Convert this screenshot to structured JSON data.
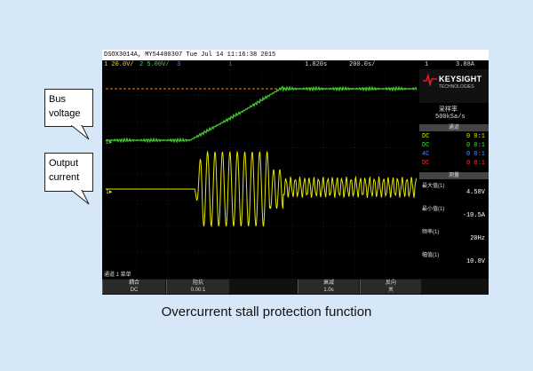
{
  "callouts": {
    "bus_voltage": [
      "Bus",
      "voltage"
    ],
    "output_current": [
      "Output",
      "current"
    ]
  },
  "caption": "Overcurrent stall protection function",
  "scope": {
    "title_bar": "DSOX3014A, MY54400307  Tue Jul 14 11:16:38 2015",
    "status": {
      "ch1": "1  20.0V/",
      "ch2": "2  5.00V/",
      "ch3": "3",
      "trigger_marker": "1",
      "time": "1.820s",
      "tdiv": "200.0s/",
      "trig_ch": "1",
      "trig_level": "3.88A"
    },
    "brand": {
      "name": "KEYSIGHT",
      "sub": "TECHNOLOGIES"
    },
    "panel": {
      "acq_line1": "采样率",
      "acq_line2": "500kSa/s",
      "ch_header": "通道",
      "channels": [
        {
          "label": "DC",
          "value": "0 0:1",
          "color": "#e6e600"
        },
        {
          "label": "DC",
          "value": "0 0:1",
          "color": "#44dd44"
        },
        {
          "label": "4C",
          "value": "0 0:1",
          "color": "#5588ff"
        },
        {
          "label": "DC",
          "value": "0 0:1",
          "color": "#ff3333"
        }
      ],
      "meas_header": "测量",
      "meas": [
        {
          "label": "最大值(1)",
          "value": "4.58V"
        },
        {
          "label": "最小值(1)",
          "value": "-10.5A"
        },
        {
          "label": "频率(1)",
          "value": "20Hz"
        },
        {
          "label": "幅值(1)",
          "value": "10.8V"
        }
      ]
    },
    "bottom_label": "通道 1 菜单",
    "softkeys": [
      {
        "top": "耦合",
        "bottom": "DC"
      },
      {
        "top": "阻抗",
        "bottom": "0.00:1"
      },
      {
        "top": "衰减",
        "bottom": "1.0s"
      },
      {
        "top": "反向",
        "bottom": "关"
      }
    ]
  },
  "colors": {
    "bus_trace": "#44cc33",
    "current_trace": "#e6e600",
    "ref_line": "#ff8800",
    "background": "#d6e7f7"
  },
  "icons": [
    "keysight-logo-icon",
    "channel-marker-icon",
    "trigger-marker-icon"
  ]
}
